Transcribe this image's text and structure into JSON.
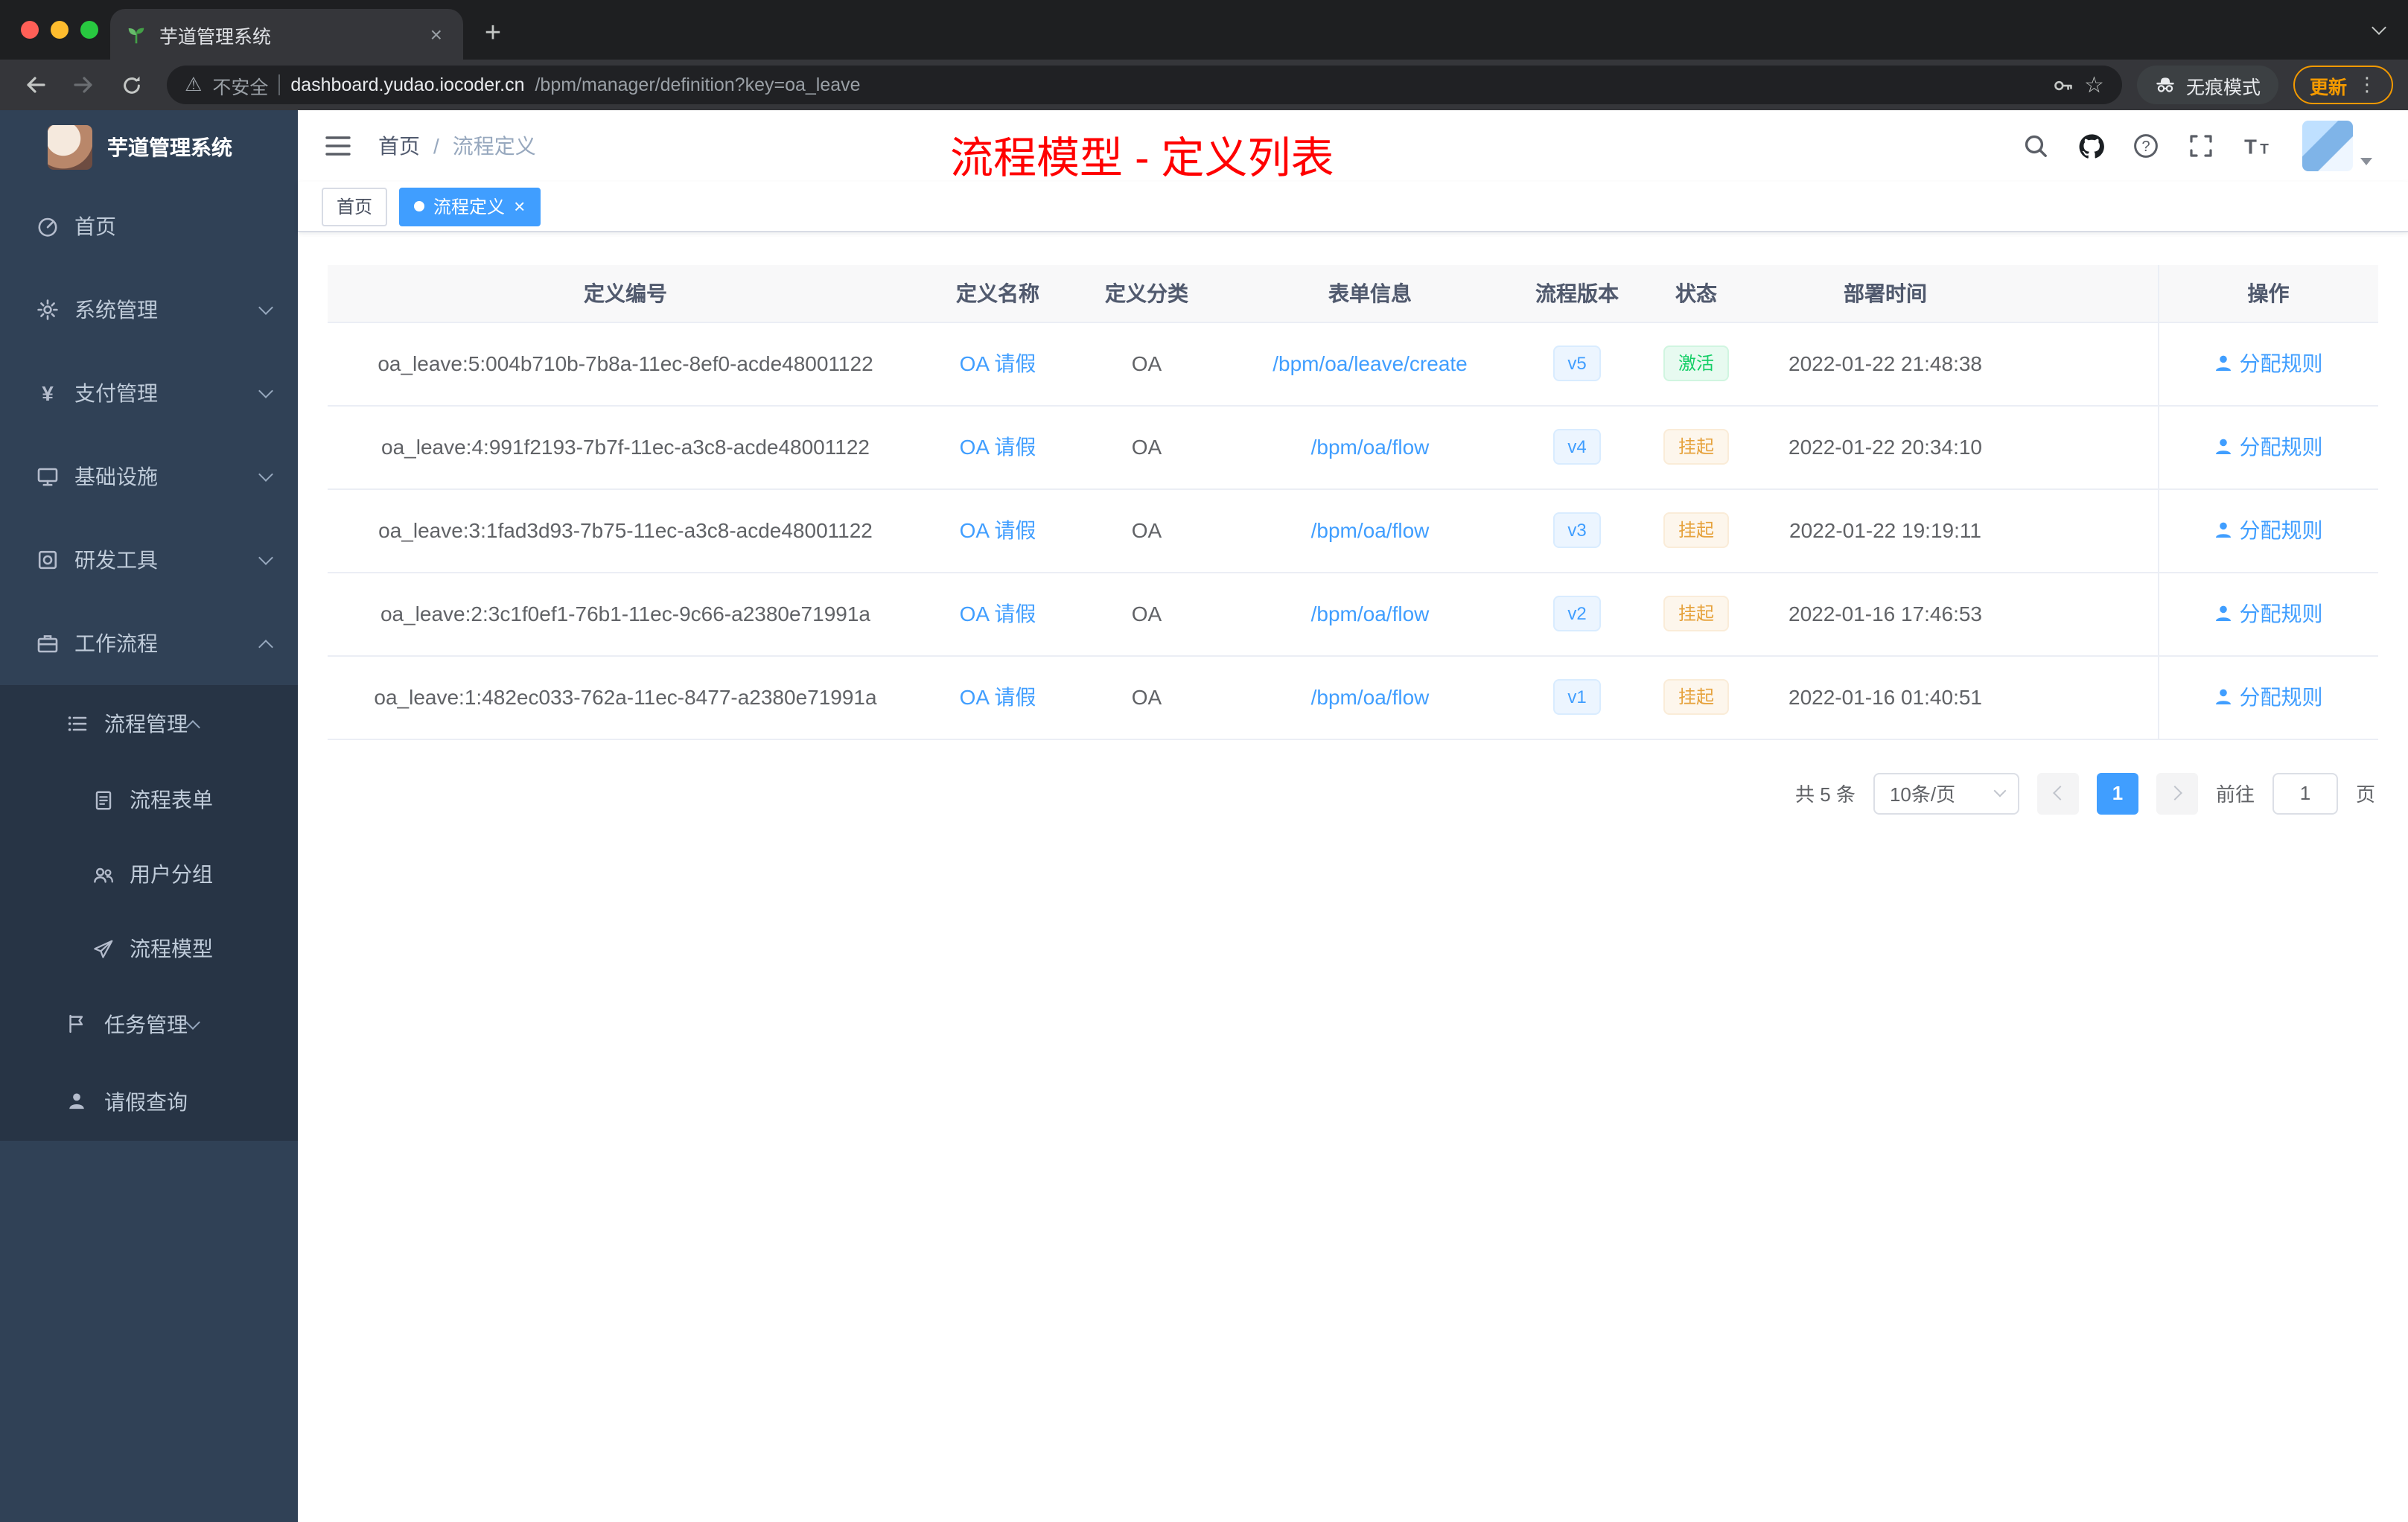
{
  "browser": {
    "tab_title": "芋道管理系统",
    "security_label": "不安全",
    "url_host": "dashboard.yudao.iocoder.cn",
    "url_path": "/bpm/manager/definition?key=oa_leave",
    "incognito_label": "无痕模式",
    "update_label": "更新"
  },
  "icons": {
    "close": "×",
    "plus": "+",
    "kebab": "⋮",
    "star": "☆",
    "warning": "⚠",
    "yen": "¥"
  },
  "sidebar": {
    "title": "芋道管理系统",
    "items": [
      {
        "label": "首页"
      },
      {
        "label": "系统管理"
      },
      {
        "label": "支付管理"
      },
      {
        "label": "基础设施"
      },
      {
        "label": "研发工具"
      },
      {
        "label": "工作流程"
      }
    ],
    "submenu": [
      {
        "label": "流程管理"
      },
      {
        "label": "流程表单"
      },
      {
        "label": "用户分组"
      },
      {
        "label": "流程模型"
      },
      {
        "label": "任务管理"
      },
      {
        "label": "请假查询"
      }
    ]
  },
  "header": {
    "breadcrumb_home": "首页",
    "breadcrumb_separator": "/",
    "breadcrumb_current": "流程定义",
    "annotation": "流程模型 - 定义列表"
  },
  "tags": {
    "home": "首页",
    "active": "流程定义"
  },
  "table": {
    "columns": [
      "定义编号",
      "定义名称",
      "定义分类",
      "表单信息",
      "流程版本",
      "状态",
      "部署时间",
      "操作"
    ],
    "rows": [
      {
        "id": "oa_leave:5:004b710b-7b8a-11ec-8ef0-acde48001122",
        "name": "OA 请假",
        "category": "OA",
        "form": "/bpm/oa/leave/create",
        "version": "v5",
        "status": "激活",
        "status_type": "success",
        "deploy_time": "2022-01-22 21:48:38",
        "action": "分配规则"
      },
      {
        "id": "oa_leave:4:991f2193-7b7f-11ec-a3c8-acde48001122",
        "name": "OA 请假",
        "category": "OA",
        "form": "/bpm/oa/flow",
        "version": "v4",
        "status": "挂起",
        "status_type": "warning",
        "deploy_time": "2022-01-22 20:34:10",
        "action": "分配规则"
      },
      {
        "id": "oa_leave:3:1fad3d93-7b75-11ec-a3c8-acde48001122",
        "name": "OA 请假",
        "category": "OA",
        "form": "/bpm/oa/flow",
        "version": "v3",
        "status": "挂起",
        "status_type": "warning",
        "deploy_time": "2022-01-22 19:19:11",
        "action": "分配规则"
      },
      {
        "id": "oa_leave:2:3c1f0ef1-76b1-11ec-9c66-a2380e71991a",
        "name": "OA 请假",
        "category": "OA",
        "form": "/bpm/oa/flow",
        "version": "v2",
        "status": "挂起",
        "status_type": "warning",
        "deploy_time": "2022-01-16 17:46:53",
        "action": "分配规则"
      },
      {
        "id": "oa_leave:1:482ec033-762a-11ec-8477-a2380e71991a",
        "name": "OA 请假",
        "category": "OA",
        "form": "/bpm/oa/flow",
        "version": "v1",
        "status": "挂起",
        "status_type": "warning",
        "deploy_time": "2022-01-16 01:40:51",
        "action": "分配规则"
      }
    ]
  },
  "pagination": {
    "total": "共 5 条",
    "page_size": "10条/页",
    "current_page": "1",
    "goto_label": "前往",
    "goto_value": "1",
    "page_unit": "页"
  }
}
